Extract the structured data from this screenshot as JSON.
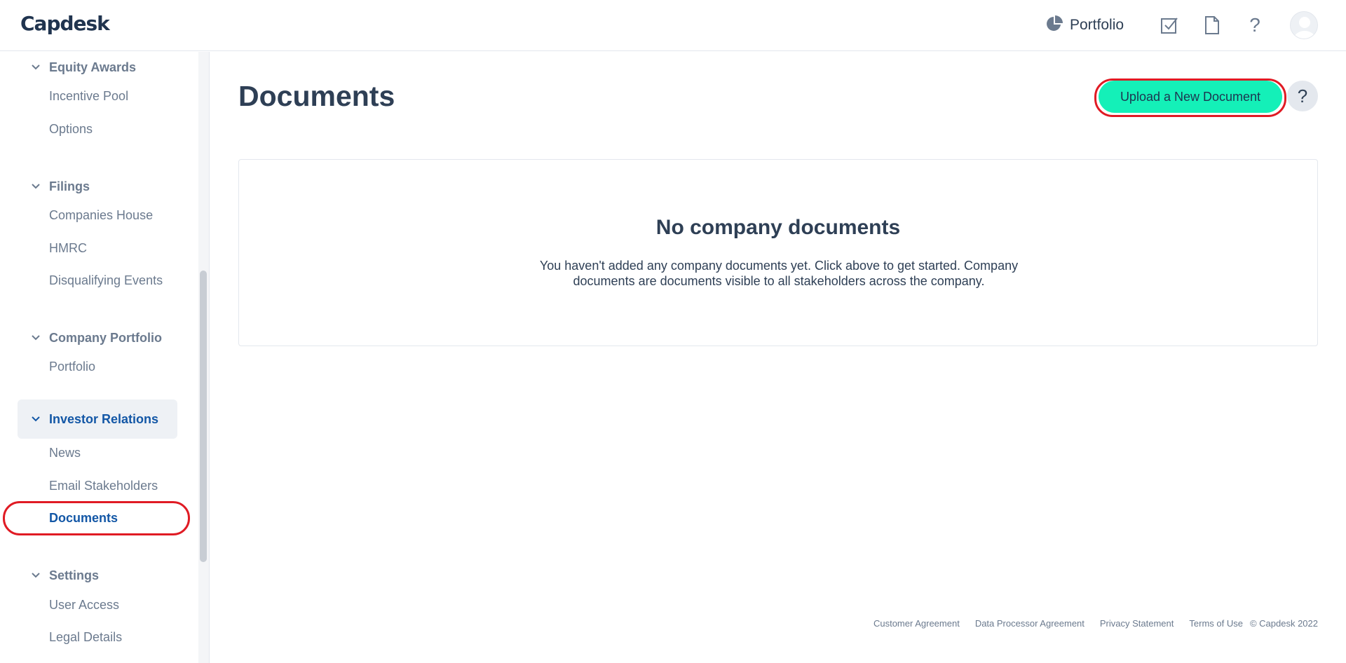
{
  "app": {
    "logo": "Capdesk"
  },
  "topbar": {
    "portfolio_label": "Portfolio",
    "icons": [
      "pie-chart-icon",
      "tasks-icon",
      "document-icon",
      "help-icon",
      "avatar"
    ]
  },
  "sidebar": {
    "sections": [
      {
        "label": "Equity Awards",
        "items": [
          "Incentive Pool",
          "Options"
        ]
      },
      {
        "label": "Filings",
        "items": [
          "Companies House",
          "HMRC",
          "Disqualifying Events"
        ]
      },
      {
        "label": "Company Portfolio",
        "items": [
          "Portfolio"
        ]
      },
      {
        "label": "Investor Relations",
        "items": [
          "News",
          "Email Stakeholders",
          "Documents"
        ],
        "active": true
      },
      {
        "label": "Settings",
        "items": [
          "User Access",
          "Legal Details"
        ]
      }
    ],
    "active_item": "Documents"
  },
  "main": {
    "title": "Documents",
    "upload_label": "Upload a New Document",
    "help_label": "?",
    "empty": {
      "title": "No company documents",
      "description": "You haven't added any company documents yet. Click above to get started. Company documents are documents visible to all stakeholders across the company."
    }
  },
  "footer": {
    "links": [
      "Customer Agreement",
      "Data Processor Agreement",
      "Privacy Statement",
      "Terms of Use"
    ],
    "copyright": "© Capdesk 2022"
  },
  "colors": {
    "accent": "#14f0b8",
    "active_text": "#1357a6",
    "highlight_ring": "#e01b24"
  }
}
